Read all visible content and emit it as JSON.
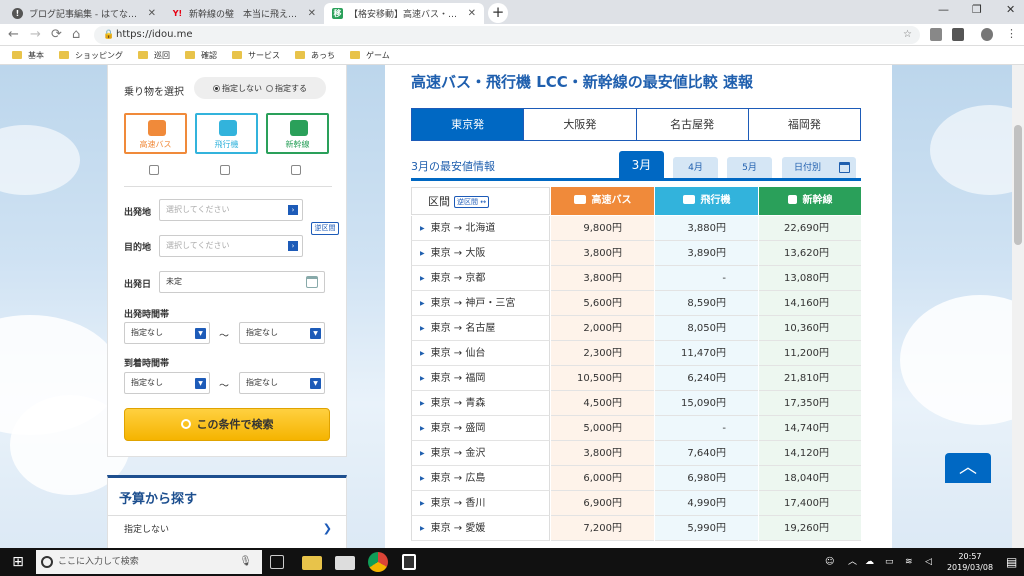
{
  "browser": {
    "tabs": [
      {
        "title": "ブログ記事編集 - はてなブログ",
        "icon": "hatena-icon"
      },
      {
        "title": "新幹線の璧　本当に飛えなければいけない",
        "icon": "yahoo-icon"
      },
      {
        "title": "【格安移動】高速バス・飛行機・LCC・新幹線",
        "icon": "idou-favicon"
      }
    ],
    "url": "https://idou.me",
    "bookmarks": [
      "基本",
      "ショッピング",
      "巡回",
      "確認",
      "サービス",
      "あっち",
      "ゲーム"
    ]
  },
  "search_panel": {
    "vehicle_label": "乗り物を選択",
    "radio_unspecified": "指定しない",
    "radio_specify": "指定する",
    "modes": [
      "高速バス",
      "飛行機",
      "新幹線"
    ],
    "origin_label": "出発地",
    "origin_placeholder": "選択してください",
    "dest_label": "目的地",
    "dest_placeholder": "選択してください",
    "swap_label": "逆区間",
    "date_label": "出発日",
    "date_value": "未定",
    "depart_time_label": "出発時間帯",
    "arrive_time_label": "到着時間帯",
    "time_option": "指定なし",
    "tilde": "〜",
    "search_button": "この条件で検索"
  },
  "budget": {
    "title": "予算から探す",
    "item": "指定しない"
  },
  "main": {
    "title": "高速バス・飛行機 LCC・新幹線の最安値比較 速報",
    "origin_tabs": [
      "東京発",
      "大阪発",
      "名古屋発",
      "福岡発"
    ],
    "active_origin": 0,
    "subtitle": "3月の最安値情報",
    "month_tabs": [
      "3月",
      "4月",
      "5月",
      "日付別"
    ],
    "active_month": 0,
    "table": {
      "section_header": "区間",
      "reverse_label": "逆区間",
      "col_bus": "高速バス",
      "col_plane": "飛行機",
      "col_shinkansen": "新幹線",
      "rows": [
        {
          "route": "東京 → 北海道",
          "bus": "9,800円",
          "plane": "3,880円",
          "shinkansen": "22,690円"
        },
        {
          "route": "東京 → 大阪",
          "bus": "3,800円",
          "plane": "3,890円",
          "shinkansen": "13,620円"
        },
        {
          "route": "東京 → 京都",
          "bus": "3,800円",
          "plane": "-",
          "shinkansen": "13,080円"
        },
        {
          "route": "東京 → 神戸・三宮",
          "bus": "5,600円",
          "plane": "8,590円",
          "shinkansen": "14,160円"
        },
        {
          "route": "東京 → 名古屋",
          "bus": "2,000円",
          "plane": "8,050円",
          "shinkansen": "10,360円"
        },
        {
          "route": "東京 → 仙台",
          "bus": "2,300円",
          "plane": "11,470円",
          "shinkansen": "11,200円"
        },
        {
          "route": "東京 → 福岡",
          "bus": "10,500円",
          "plane": "6,240円",
          "shinkansen": "21,810円"
        },
        {
          "route": "東京 → 青森",
          "bus": "4,500円",
          "plane": "15,090円",
          "shinkansen": "17,350円"
        },
        {
          "route": "東京 → 盛岡",
          "bus": "5,000円",
          "plane": "-",
          "shinkansen": "14,740円"
        },
        {
          "route": "東京 → 金沢",
          "bus": "3,800円",
          "plane": "7,640円",
          "shinkansen": "14,120円"
        },
        {
          "route": "東京 → 広島",
          "bus": "6,000円",
          "plane": "6,980円",
          "shinkansen": "18,040円"
        },
        {
          "route": "東京 → 香川",
          "bus": "6,900円",
          "plane": "4,990円",
          "shinkansen": "17,400円"
        },
        {
          "route": "東京 → 愛媛",
          "bus": "7,200円",
          "plane": "5,990円",
          "shinkansen": "19,260円"
        }
      ]
    }
  },
  "taskbar": {
    "search_placeholder": "ここに入力して検索",
    "time": "20:57",
    "date": "2019/03/08"
  },
  "colors": {
    "accent": "#0068c3",
    "bus": "#f08a3a",
    "plane": "#32b3dc",
    "shinkansen": "#2aa05a",
    "search_button": "#f5b400"
  }
}
